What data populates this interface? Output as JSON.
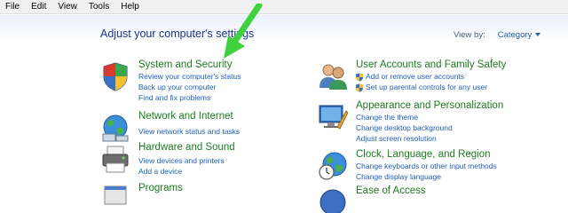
{
  "menu": [
    "File",
    "Edit",
    "View",
    "Tools",
    "Help"
  ],
  "header": {
    "title": "Adjust your computer's settings",
    "view_by_label": "View by:",
    "view_by_value": "Category"
  },
  "categories": {
    "system_security": {
      "title": "System and Security",
      "links": [
        "Review your computer's status",
        "Back up your computer",
        "Find and fix problems"
      ]
    },
    "network": {
      "title": "Network and Internet",
      "links": [
        "View network status and tasks"
      ]
    },
    "hardware": {
      "title": "Hardware and Sound",
      "links": [
        "View devices and printers",
        "Add a device"
      ]
    },
    "programs": {
      "title": "Programs"
    },
    "user_accounts": {
      "title": "User Accounts and Family Safety",
      "links": [
        "Add or remove user accounts",
        "Set up parental controls for any user"
      ]
    },
    "appearance": {
      "title": "Appearance and Personalization",
      "links": [
        "Change the theme",
        "Change desktop background",
        "Adjust screen resolution"
      ]
    },
    "clock": {
      "title": "Clock, Language, and Region",
      "links": [
        "Change keyboards or other input methods",
        "Change display language"
      ]
    },
    "ease": {
      "title": "Ease of Access"
    }
  },
  "colors": {
    "title_green": "#1e7a1e",
    "link_blue": "#1e5fb5",
    "heading_blue": "#1e3287",
    "annotation_arrow": "#3fd23f"
  },
  "icons": [
    "shield-flag-icon",
    "globe-network-icon",
    "printer-icon",
    "programs-icon",
    "users-icon",
    "appearance-icon",
    "clock-globe-icon",
    "ease-of-access-icon",
    "uac-shield-icon"
  ]
}
